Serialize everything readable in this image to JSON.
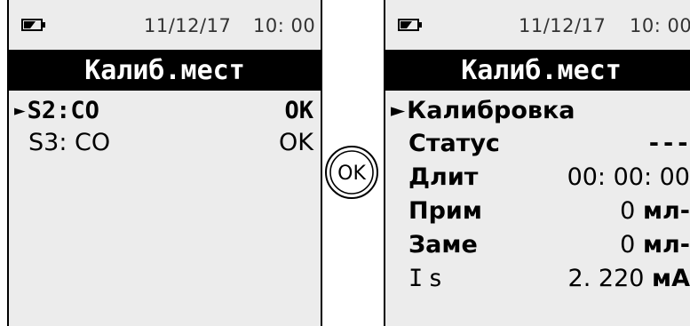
{
  "status": {
    "date": "11/12/17",
    "time": "10: 00"
  },
  "screens": {
    "left": {
      "title": "Калиб.мест",
      "items": [
        {
          "arrow": "►",
          "label": "S2:CO",
          "value": "OK"
        },
        {
          "label": "S3: CO",
          "value": "OK"
        }
      ]
    },
    "right": {
      "title": "Калиб.мест",
      "items": [
        {
          "arrow": "►",
          "label": "Калибровка",
          "value": ""
        },
        {
          "label": "Статус",
          "value": "---"
        },
        {
          "label": "Длит",
          "value": "00: 00: 00"
        },
        {
          "label": "Прим",
          "value_num": "0",
          "value_unit": "мл-"
        },
        {
          "label": "Заме",
          "value_num": "0",
          "value_unit": "мл-"
        },
        {
          "label": "Is",
          "value_num": "2. 220",
          "value_unit": "мА"
        }
      ]
    }
  },
  "ok_button": {
    "label": "OK"
  },
  "icons": {
    "battery": "battery-icon"
  },
  "colors": {
    "screen_bg": "#ececec",
    "title_bg": "#000000",
    "title_fg": "#ffffff"
  }
}
